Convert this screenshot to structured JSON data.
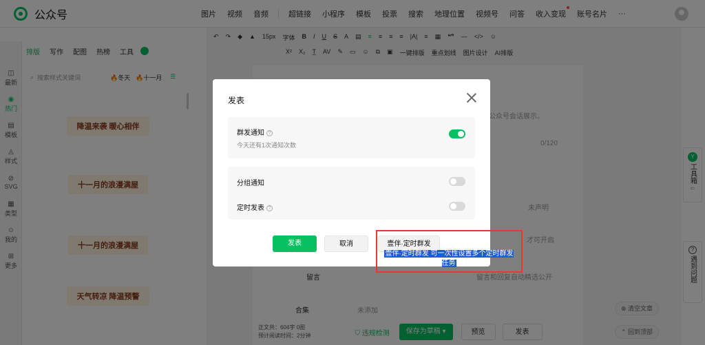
{
  "app": {
    "name": "公众号"
  },
  "top_menu": [
    "图片",
    "视频",
    "音频",
    "超链接",
    "小程序",
    "模板",
    "投票",
    "搜索",
    "地理位置",
    "视频号",
    "问答",
    "收入变现",
    "账号名片",
    "···"
  ],
  "toolbar": {
    "row1": [
      "↶",
      "↷",
      "◆",
      "▲",
      "15px",
      "字体",
      "B",
      "I",
      "U",
      "S",
      "A",
      "▤",
      "≡",
      "≡",
      "≡",
      "≡",
      "|A|",
      "≡",
      "▦",
      "❝❞",
      "—",
      "</>",
      "☺"
    ],
    "row2": [
      "X²",
      "X₂",
      "T̲",
      "AV",
      "✎",
      "▭",
      "☺",
      "⧉",
      "▣",
      "一键排版",
      "重点划线",
      "图片设计",
      "AI排版"
    ]
  },
  "library": {
    "tabs": [
      "排版",
      "写作",
      "配图",
      "热榜",
      "工具"
    ],
    "active_tab": "排版",
    "search_placeholder": "搜索样式关键词",
    "tags": [
      "冬天",
      "十一月"
    ],
    "cards": [
      "降温来袭 暖心相伴",
      "十一月的浪漫满屋",
      "十一月的浪漫满屋",
      "天气转凉 降温预警"
    ]
  },
  "sidebar": {
    "items": [
      {
        "icon": "◫",
        "label": "最新"
      },
      {
        "icon": "◉",
        "label": "热门",
        "active": true
      },
      {
        "icon": "▤",
        "label": "模板"
      },
      {
        "icon": "◬",
        "label": "样式"
      },
      {
        "icon": "⊘",
        "label": "SVG"
      },
      {
        "icon": "▦",
        "label": "类型"
      },
      {
        "icon": "☺",
        "label": "我的"
      },
      {
        "icon": "⊞",
        "label": "更多"
      }
    ]
  },
  "editor": {
    "hint_right": "公众号会话展示。",
    "count": "0/120",
    "declare": "未声明",
    "open_hint": "才可开启",
    "comment": "留言",
    "comment_state": "留言和回复自动精选公开",
    "collection": "合集",
    "collection_state": "未添加"
  },
  "modal": {
    "title": "发表",
    "mass_notify": {
      "label": "群发通知",
      "sub": "今天还有1次通知次数",
      "on": true
    },
    "group_notify": {
      "label": "分组通知",
      "on": false
    },
    "scheduled": {
      "label": "定时发表",
      "on": false
    },
    "buttons": {
      "publish": "发表",
      "cancel": "取消",
      "ext": "壹伴·定时群发"
    }
  },
  "tooltip": {
    "text": "壹伴·定时群发 可一次性设置多个定时群发任务"
  },
  "bottom": {
    "word_count": "正文共：604字 0图",
    "read_time": "预计阅读时间：2分钟",
    "check": "违规检测",
    "save_draft": "保存为草稿",
    "preview": "预览",
    "publish": "发表"
  },
  "right_float": {
    "toolbox": "工具箱",
    "help": "遇到问题"
  },
  "bottom_right": {
    "clear": "清空文章",
    "back_top": "回到顶部"
  }
}
